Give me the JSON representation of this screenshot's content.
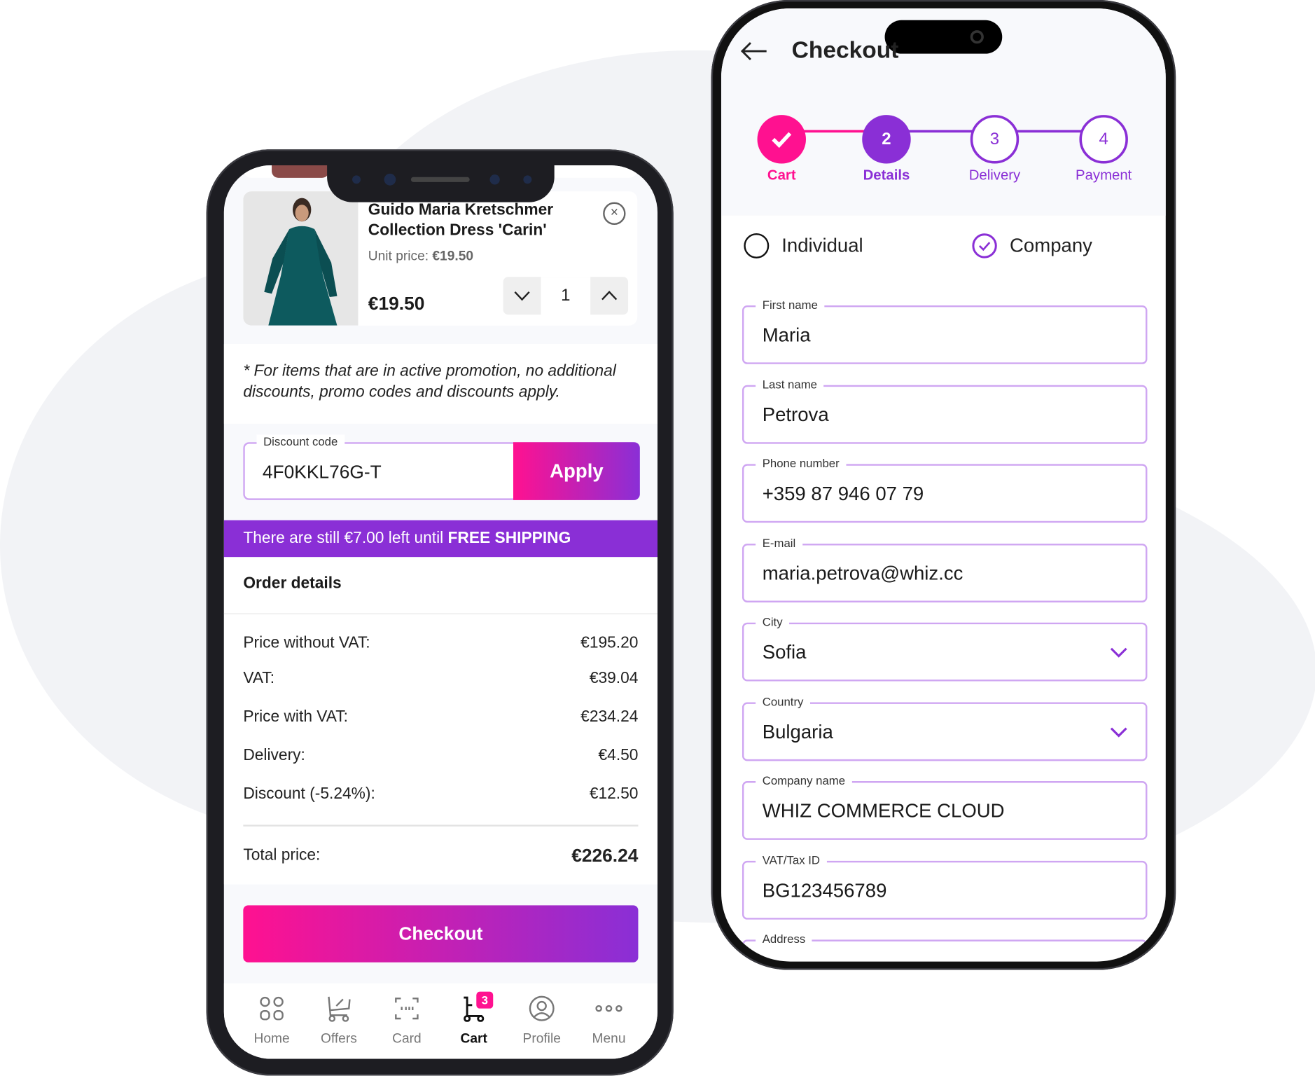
{
  "cart_screen": {
    "product": {
      "title_line1": "Guido Maria Kretschmer",
      "title_line2": "Collection Dress 'Carin'",
      "unit_price_label": "Unit price:",
      "unit_price": "€19.50",
      "price": "€19.50",
      "quantity": "1"
    },
    "promo_note_line1": "* For items that are in active promotion, no additional",
    "promo_note_line2": "discounts, promo codes and discounts apply.",
    "discount": {
      "label": "Discount code",
      "value": "4F0KKL76G-T",
      "apply_label": "Apply"
    },
    "shipping_banner": {
      "text": "There are still €7.00 left until ",
      "highlight": "FREE SHIPPING"
    },
    "order_details": {
      "title": "Order details",
      "rows": [
        {
          "label": "Price without VAT:",
          "value": "€195.20"
        },
        {
          "label": "VAT:",
          "value": "€39.04"
        },
        {
          "label": "Price with VAT:",
          "value": "€234.24"
        },
        {
          "label": "Delivery:",
          "value": "€4.50"
        },
        {
          "label": "Discount (-5.24%):",
          "value": "€12.50"
        }
      ],
      "total_label": "Total price:",
      "total_value": "€226.24"
    },
    "checkout_label": "Checkout",
    "nav": [
      {
        "label": "Home",
        "icon": "grid-icon"
      },
      {
        "label": "Offers",
        "icon": "cart-percent-icon"
      },
      {
        "label": "Card",
        "icon": "scan-card-icon"
      },
      {
        "label": "Cart",
        "icon": "cart-icon",
        "badge": "3",
        "active": true
      },
      {
        "label": "Profile",
        "icon": "user-circle-icon"
      },
      {
        "label": "Menu",
        "icon": "more-icon"
      }
    ]
  },
  "checkout_screen": {
    "title": "Checkout",
    "steps": [
      {
        "number": "1",
        "label": "Cart",
        "state": "done"
      },
      {
        "number": "2",
        "label": "Details",
        "state": "active"
      },
      {
        "number": "3",
        "label": "Delivery",
        "state": "pending"
      },
      {
        "number": "4",
        "label": "Payment",
        "state": "pending"
      }
    ],
    "customer_type": {
      "individual": "Individual",
      "company": "Company",
      "selected": "Company"
    },
    "fields": [
      {
        "label": "First name",
        "value": "Maria"
      },
      {
        "label": "Last name",
        "value": "Petrova"
      },
      {
        "label": "Phone number",
        "value": "+359 87 946 07 79"
      },
      {
        "label": "E-mail",
        "value": "maria.petrova@whiz.cc"
      },
      {
        "label": "City",
        "value": "Sofia",
        "dropdown": true
      },
      {
        "label": "Country",
        "value": "Bulgaria",
        "dropdown": true
      },
      {
        "label": "Company name",
        "value": "WHIZ COMMERCE CLOUD"
      },
      {
        "label": "VAT/Tax ID",
        "value": "BG123456789"
      },
      {
        "label": "Address",
        "value": ""
      }
    ]
  },
  "colors": {
    "pink": "#ff1190",
    "purple": "#8a2fd6",
    "field_border": "#cfa6f2",
    "bg_soft": "#f8f9fc"
  }
}
